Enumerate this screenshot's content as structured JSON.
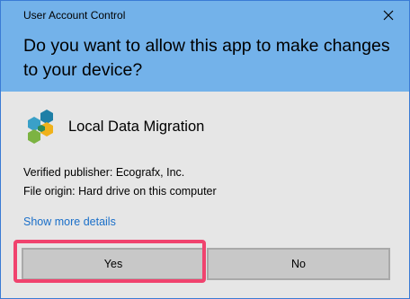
{
  "window": {
    "title": "User Account Control",
    "close_icon": "close-icon",
    "border_color": "#3a7bd5"
  },
  "header": {
    "question": "Do you want to allow this app to make changes to your device?",
    "background": "#73b2ea"
  },
  "app": {
    "name": "Local Data Migration",
    "icon": "hexagon-cluster-icon",
    "publisher": "Verified publisher: Ecografx, Inc.",
    "origin": "File origin: Hard drive on this computer"
  },
  "more_details": "Show more details",
  "buttons": {
    "yes": "Yes",
    "no": "No"
  },
  "highlight_color": "#f0436e"
}
